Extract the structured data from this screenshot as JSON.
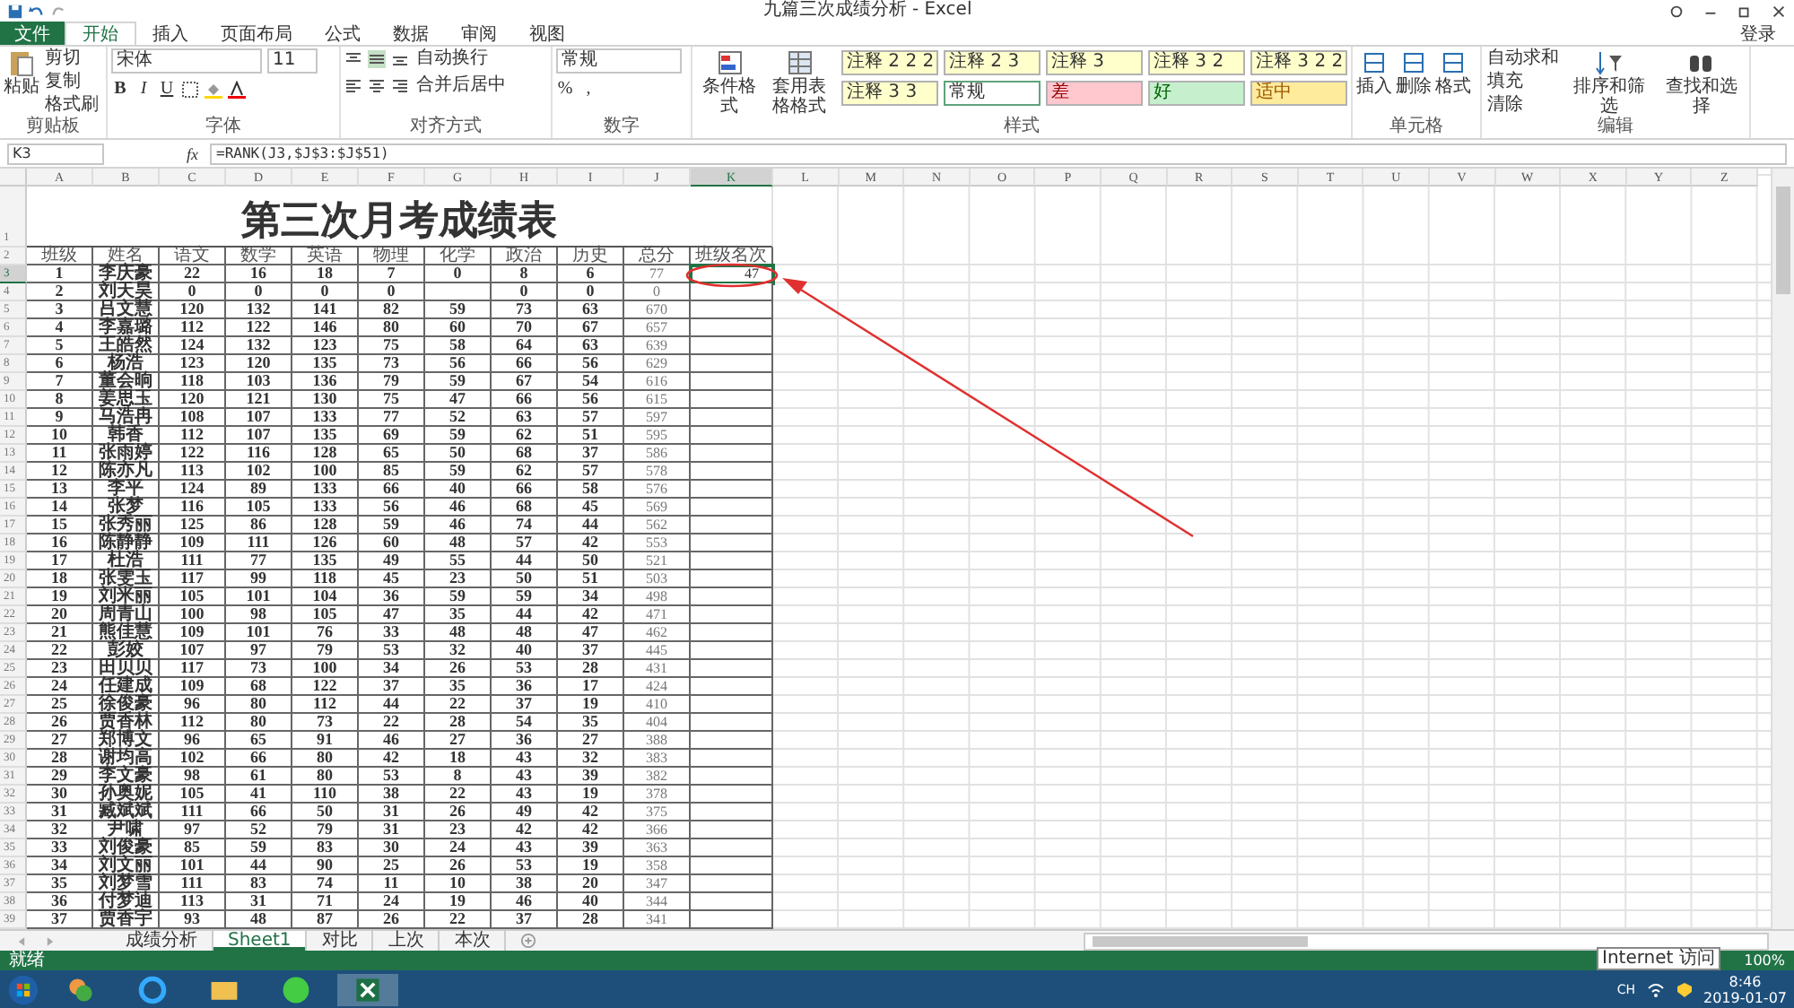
{
  "window": {
    "title": "九篇三次成绩分析 - Excel",
    "login": "登录"
  },
  "ribbon_tabs": [
    {
      "label": "文件",
      "kind": "file",
      "selected": false
    },
    {
      "label": "开始",
      "kind": "tab",
      "selected": true
    },
    {
      "label": "插入",
      "kind": "tab",
      "selected": false
    },
    {
      "label": "页面布局",
      "kind": "tab",
      "selected": false
    },
    {
      "label": "公式",
      "kind": "tab",
      "selected": false
    },
    {
      "label": "数据",
      "kind": "tab",
      "selected": false
    },
    {
      "label": "审阅",
      "kind": "tab",
      "selected": false
    },
    {
      "label": "视图",
      "kind": "tab",
      "selected": false
    }
  ],
  "clipboard": {
    "paste": "粘贴",
    "cut": "剪切",
    "copy": "复制",
    "format_painter": "格式刷",
    "label": "剪贴板"
  },
  "font": {
    "name": "宋体",
    "size": "11",
    "bold": "B",
    "italic": "I",
    "underline": "U",
    "label": "字体"
  },
  "alignment": {
    "wrap": "自动换行",
    "merge": "合并后居中",
    "label": "对齐方式"
  },
  "number": {
    "format": "常规",
    "percent": "%",
    "comma": ",",
    "label": "数字"
  },
  "styles": {
    "conditional": "条件格式",
    "table": "套用表格格式",
    "label": "样式",
    "cells": [
      {
        "label": "注释 2 2 2",
        "kind": "note"
      },
      {
        "label": "注释 2 3",
        "kind": "note"
      },
      {
        "label": "注释 3",
        "kind": "note"
      },
      {
        "label": "注释 3 2",
        "kind": "note"
      },
      {
        "label": "注释 3 2 2",
        "kind": "note"
      },
      {
        "label": "注释 3 3",
        "kind": "note"
      },
      {
        "label": "常规",
        "kind": "normal"
      },
      {
        "label": "差",
        "kind": "bad"
      },
      {
        "label": "好",
        "kind": "good"
      },
      {
        "label": "适中",
        "kind": "neutral"
      }
    ]
  },
  "cells_group": {
    "items": [
      "插入",
      "删除",
      "格式"
    ],
    "label": "单元格"
  },
  "editing": {
    "autosum": "自动求和",
    "fill": "填充",
    "clear": "清除",
    "sort": "排序和筛选",
    "find": "查找和选择",
    "label": "编辑"
  },
  "formula_bar": {
    "name_box": "K3",
    "fx": "fx",
    "formula": "=RANK(J3,$J$3:$J$51)"
  },
  "column_headers": [
    {
      "label": "A",
      "selected": false
    },
    {
      "label": "B",
      "selected": false
    },
    {
      "label": "C",
      "selected": false
    },
    {
      "label": "D",
      "selected": false
    },
    {
      "label": "E",
      "selected": false
    },
    {
      "label": "F",
      "selected": false
    },
    {
      "label": "G",
      "selected": false
    },
    {
      "label": "H",
      "selected": false
    },
    {
      "label": "I",
      "selected": false
    },
    {
      "label": "J",
      "selected": false
    },
    {
      "label": "K",
      "selected": true
    },
    {
      "label": "L",
      "selected": false
    },
    {
      "label": "M",
      "selected": false
    },
    {
      "label": "N",
      "selected": false
    },
    {
      "label": "O",
      "selected": false
    },
    {
      "label": "P",
      "selected": false
    },
    {
      "label": "Q",
      "selected": false
    },
    {
      "label": "R",
      "selected": false
    },
    {
      "label": "S",
      "selected": false
    },
    {
      "label": "T",
      "selected": false
    },
    {
      "label": "U",
      "selected": false
    },
    {
      "label": "V",
      "selected": false
    },
    {
      "label": "W",
      "selected": false
    },
    {
      "label": "X",
      "selected": false
    },
    {
      "label": "Y",
      "selected": false
    },
    {
      "label": "Z",
      "selected": false
    }
  ],
  "sheet_title": {
    "num": "1",
    "text": "第三次月考成绩表"
  },
  "table_header": {
    "num": "2",
    "labels": [
      "班级",
      "姓名",
      "语文",
      "数学",
      "英语",
      "物理",
      "化学",
      "政治",
      "历史",
      "总分",
      "班级名次"
    ]
  },
  "rows": [
    {
      "num": "3",
      "selected": true,
      "cells": [
        "1",
        "李庆豪",
        "22",
        "16",
        "18",
        "7",
        "0",
        "8",
        "6",
        "77"
      ],
      "rank": "47"
    },
    {
      "num": "4",
      "selected": false,
      "cells": [
        "2",
        "刘天昊",
        "0",
        "0",
        "0",
        "0",
        null,
        "0",
        "0",
        "0"
      ]
    },
    {
      "num": "5",
      "selected": false,
      "cells": [
        "3",
        "吕文慧",
        "120",
        "132",
        "141",
        "82",
        "59",
        "73",
        "63",
        "670"
      ]
    },
    {
      "num": "6",
      "selected": false,
      "cells": [
        "4",
        "李嘉璐",
        "112",
        "122",
        "146",
        "80",
        "60",
        "70",
        "67",
        "657"
      ]
    },
    {
      "num": "7",
      "selected": false,
      "cells": [
        "5",
        "王皓然",
        "124",
        "132",
        "123",
        "75",
        "58",
        "64",
        "63",
        "639"
      ]
    },
    {
      "num": "8",
      "selected": false,
      "cells": [
        "6",
        "杨浩",
        "123",
        "120",
        "135",
        "73",
        "56",
        "66",
        "56",
        "629"
      ]
    },
    {
      "num": "9",
      "selected": false,
      "cells": [
        "7",
        "董会晌",
        "118",
        "103",
        "136",
        "79",
        "59",
        "67",
        "54",
        "616"
      ]
    },
    {
      "num": "10",
      "selected": false,
      "cells": [
        "8",
        "姜思玉",
        "120",
        "121",
        "130",
        "75",
        "47",
        "66",
        "56",
        "615"
      ]
    },
    {
      "num": "11",
      "selected": false,
      "cells": [
        "9",
        "马浩冉",
        "108",
        "107",
        "133",
        "77",
        "52",
        "63",
        "57",
        "597"
      ]
    },
    {
      "num": "12",
      "selected": false,
      "cells": [
        "10",
        "韩香",
        "112",
        "107",
        "135",
        "69",
        "59",
        "62",
        "51",
        "595"
      ]
    },
    {
      "num": "13",
      "selected": false,
      "cells": [
        "11",
        "张雨婷",
        "122",
        "116",
        "128",
        "65",
        "50",
        "68",
        "37",
        "586"
      ]
    },
    {
      "num": "14",
      "selected": false,
      "cells": [
        "12",
        "陈亦凡",
        "113",
        "102",
        "100",
        "85",
        "59",
        "62",
        "57",
        "578"
      ]
    },
    {
      "num": "15",
      "selected": false,
      "cells": [
        "13",
        "李平",
        "124",
        "89",
        "133",
        "66",
        "40",
        "66",
        "58",
        "576"
      ]
    },
    {
      "num": "16",
      "selected": false,
      "cells": [
        "14",
        "张梦",
        "116",
        "105",
        "133",
        "56",
        "46",
        "68",
        "45",
        "569"
      ]
    },
    {
      "num": "17",
      "selected": false,
      "cells": [
        "15",
        "张秀丽",
        "125",
        "86",
        "128",
        "59",
        "46",
        "74",
        "44",
        "562"
      ]
    },
    {
      "num": "18",
      "selected": false,
      "cells": [
        "16",
        "陈静静",
        "109",
        "111",
        "126",
        "60",
        "48",
        "57",
        "42",
        "553"
      ]
    },
    {
      "num": "19",
      "selected": false,
      "cells": [
        "17",
        "杜浩",
        "111",
        "77",
        "135",
        "49",
        "55",
        "44",
        "50",
        "521"
      ]
    },
    {
      "num": "20",
      "selected": false,
      "cells": [
        "18",
        "张雯玉",
        "117",
        "99",
        "118",
        "45",
        "23",
        "50",
        "51",
        "503"
      ]
    },
    {
      "num": "21",
      "selected": false,
      "cells": [
        "19",
        "刘米丽",
        "105",
        "101",
        "104",
        "36",
        "59",
        "59",
        "34",
        "498"
      ]
    },
    {
      "num": "22",
      "selected": false,
      "cells": [
        "20",
        "周青山",
        "100",
        "98",
        "105",
        "47",
        "35",
        "44",
        "42",
        "471"
      ]
    },
    {
      "num": "23",
      "selected": false,
      "cells": [
        "21",
        "熊佳慧",
        "109",
        "101",
        "76",
        "33",
        "48",
        "48",
        "47",
        "462"
      ]
    },
    {
      "num": "24",
      "selected": false,
      "cells": [
        "22",
        "彭姣",
        "107",
        "97",
        "79",
        "53",
        "32",
        "40",
        "37",
        "445"
      ]
    },
    {
      "num": "25",
      "selected": false,
      "cells": [
        "23",
        "田贝贝",
        "117",
        "73",
        "100",
        "34",
        "26",
        "53",
        "28",
        "431"
      ]
    },
    {
      "num": "26",
      "selected": false,
      "cells": [
        "24",
        "任建成",
        "109",
        "68",
        "122",
        "37",
        "35",
        "36",
        "17",
        "424"
      ]
    },
    {
      "num": "27",
      "selected": false,
      "cells": [
        "25",
        "徐俊豪",
        "96",
        "80",
        "112",
        "44",
        "22",
        "37",
        "19",
        "410"
      ]
    },
    {
      "num": "28",
      "selected": false,
      "cells": [
        "26",
        "贾香林",
        "112",
        "80",
        "73",
        "22",
        "28",
        "54",
        "35",
        "404"
      ]
    },
    {
      "num": "29",
      "selected": false,
      "cells": [
        "27",
        "郑博文",
        "96",
        "65",
        "91",
        "46",
        "27",
        "36",
        "27",
        "388"
      ]
    },
    {
      "num": "30",
      "selected": false,
      "cells": [
        "28",
        "谢均高",
        "102",
        "66",
        "80",
        "42",
        "18",
        "43",
        "32",
        "383"
      ]
    },
    {
      "num": "31",
      "selected": false,
      "cells": [
        "29",
        "李文豪",
        "98",
        "61",
        "80",
        "53",
        "8",
        "43",
        "39",
        "382"
      ]
    },
    {
      "num": "32",
      "selected": false,
      "cells": [
        "30",
        "孙奥妮",
        "105",
        "41",
        "110",
        "38",
        "22",
        "43",
        "19",
        "378"
      ]
    },
    {
      "num": "33",
      "selected": false,
      "cells": [
        "31",
        "臧斌斌",
        "111",
        "66",
        "50",
        "31",
        "26",
        "49",
        "42",
        "375"
      ]
    },
    {
      "num": "34",
      "selected": false,
      "cells": [
        "32",
        "尹啸",
        "97",
        "52",
        "79",
        "31",
        "23",
        "42",
        "42",
        "366"
      ]
    },
    {
      "num": "35",
      "selected": false,
      "cells": [
        "33",
        "刘俊豪",
        "85",
        "59",
        "83",
        "30",
        "24",
        "43",
        "39",
        "363"
      ]
    },
    {
      "num": "36",
      "selected": false,
      "cells": [
        "34",
        "刘文丽",
        "101",
        "44",
        "90",
        "25",
        "26",
        "53",
        "19",
        "358"
      ]
    },
    {
      "num": "37",
      "selected": false,
      "cells": [
        "35",
        "刘梦雪",
        "111",
        "83",
        "74",
        "11",
        "10",
        "38",
        "20",
        "347"
      ]
    },
    {
      "num": "38",
      "selected": false,
      "cells": [
        "36",
        "付梦迪",
        "113",
        "31",
        "71",
        "24",
        "19",
        "46",
        "40",
        "344"
      ]
    },
    {
      "num": "39",
      "selected": false,
      "cells": [
        "37",
        "贾香宇",
        "93",
        "48",
        "87",
        "26",
        "22",
        "37",
        "28",
        "341"
      ]
    }
  ],
  "sheet_tabs": [
    {
      "label": "成绩分析",
      "selected": false
    },
    {
      "label": "Sheet1",
      "selected": true
    },
    {
      "label": "对比",
      "selected": false
    },
    {
      "label": "上次",
      "selected": false
    },
    {
      "label": "本次",
      "selected": false
    }
  ],
  "status_bar": {
    "status": "就绪",
    "zoom": "100%",
    "tooltip": "Internet 访问"
  },
  "taskbar": {
    "lang": "CH",
    "time": "8:46",
    "date": "2019-01-07"
  }
}
